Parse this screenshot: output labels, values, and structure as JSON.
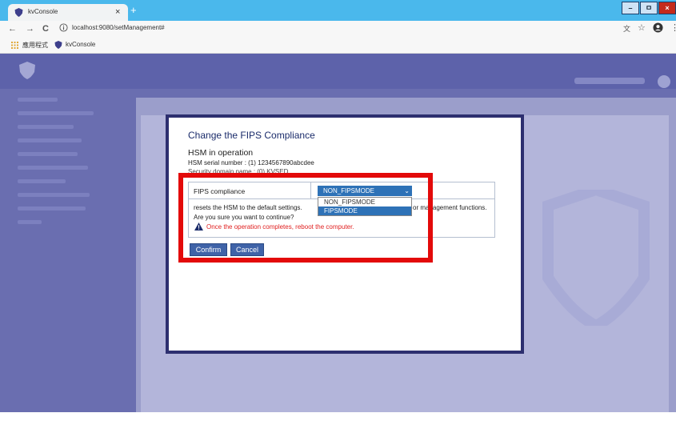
{
  "browser": {
    "tab_title": "kvConsole",
    "tab_close": "×",
    "new_tab": "+",
    "url": "localhost:9080/setManagement#",
    "nav": {
      "back": "←",
      "forward": "→",
      "reload": "C"
    },
    "bookmarks": {
      "apps_label": "應用程式",
      "kvconsole_label": "kvConsole"
    },
    "window_controls": {
      "minimize": "–",
      "restore": "ㅁ",
      "close": "×"
    },
    "icons": [
      "shield-icon",
      "info-icon",
      "translate-icon",
      "star-icon",
      "account-icon",
      "menu-icon",
      "apps-grid-icon"
    ]
  },
  "modal": {
    "title": "Change the FIPS Compliance",
    "hsm_heading": "HSM in operation",
    "hsm_serial": "HSM serial number : (1) 1234567890abcdee",
    "hsm_domain": "Security domain name : (0) KVSED",
    "fips_label": "FIPS compliance",
    "fips_selected": "NON_FIPSMODE",
    "fips_options": [
      {
        "label": "NON_FIPSMODE",
        "selected": false
      },
      {
        "label": "FIPSMODE",
        "selected": true
      }
    ],
    "warning_line1_start": "resets the HSM to the default settings.",
    "warning_line1_end": "or management functions.",
    "warning_line2": "Are you sure you want to continue?",
    "warning_line3": "Once the operation completes, reboot the computer.",
    "confirm_label": "Confirm",
    "cancel_label": "Cancel"
  },
  "colors": {
    "titlebar": "#4ab8ec",
    "overlay": "#6a6eb0",
    "modal_border": "#2d2f6f",
    "select_bg": "#2e72b7",
    "highlight": "#e30a0a",
    "warning_text": "#e02020"
  }
}
